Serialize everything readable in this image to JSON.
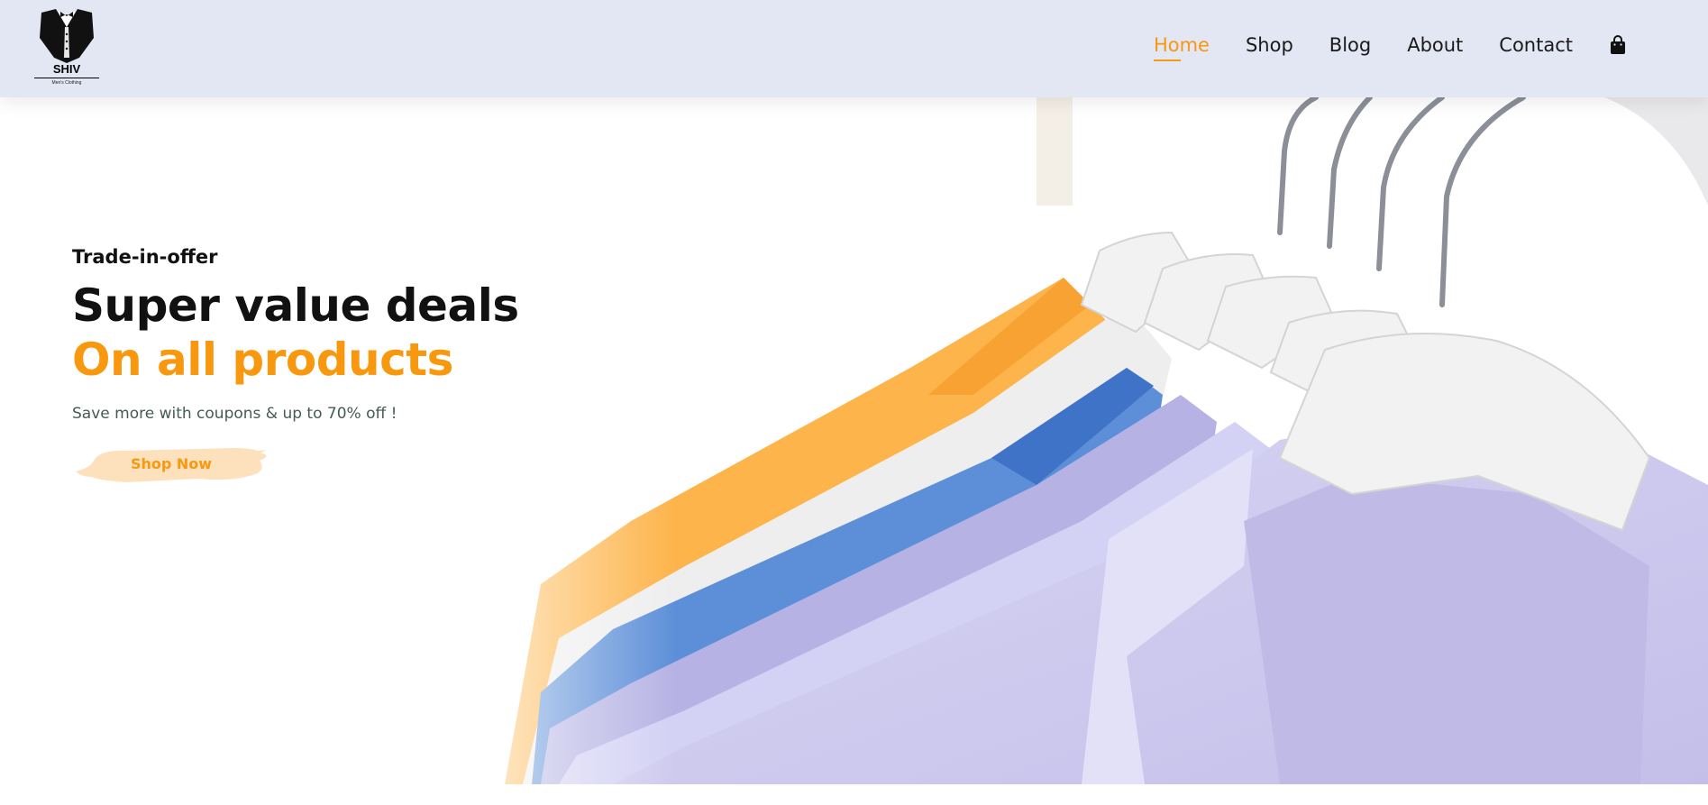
{
  "brand": {
    "name": "SHIV",
    "tagline": "Men's Clothing"
  },
  "nav": {
    "items": [
      {
        "label": "Home",
        "active": true
      },
      {
        "label": "Shop",
        "active": false
      },
      {
        "label": "Blog",
        "active": false
      },
      {
        "label": "About",
        "active": false
      },
      {
        "label": "Contact",
        "active": false
      }
    ],
    "cart_icon": "shopping-bag-icon"
  },
  "hero": {
    "eyebrow": "Trade-in-offer",
    "title_line1": "Super value deals",
    "title_line2": "On all products",
    "subtitle": "Save more with coupons & up to 70% off !",
    "cta_label": "Shop Now"
  },
  "colors": {
    "accent": "#f7980f",
    "header_bg": "#e3e6f3",
    "text_dark": "#111111",
    "text_muted": "#465b52",
    "button_bg": "#fde1bd"
  }
}
